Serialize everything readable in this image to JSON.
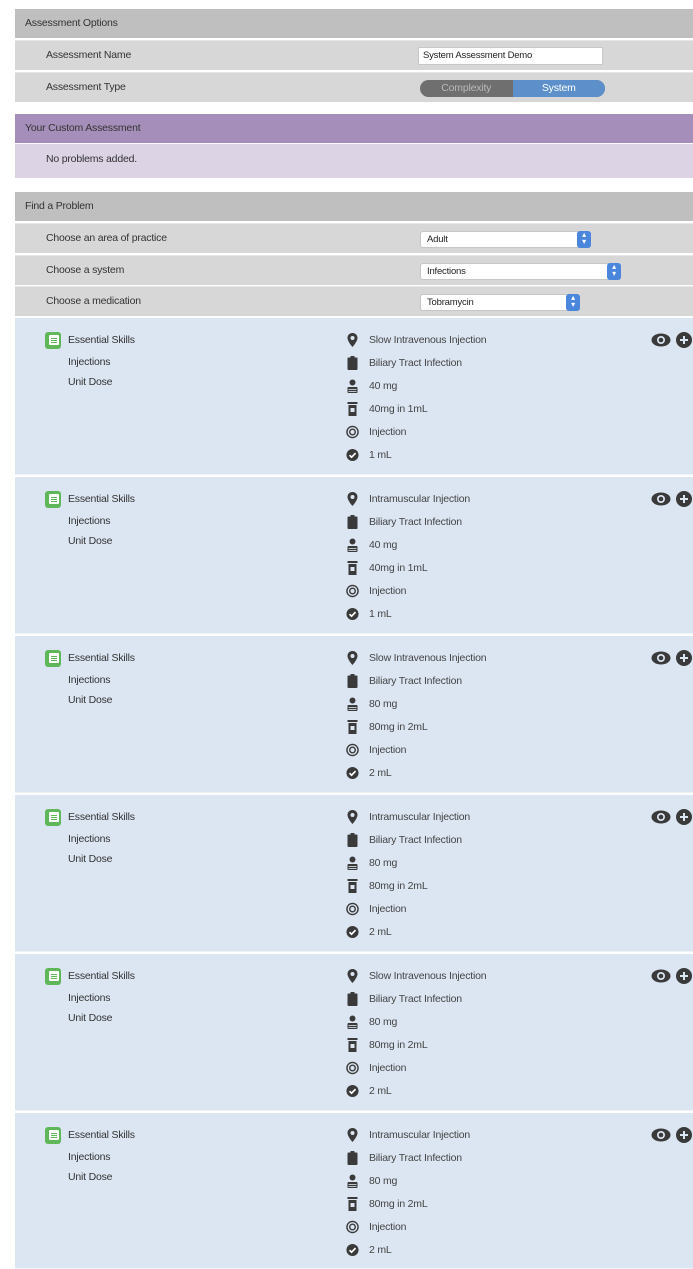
{
  "assessment_options": {
    "header": "Assessment Options",
    "name_label": "Assessment Name",
    "name_value": "System Assessment Demo",
    "type_label": "Assessment Type",
    "type_options": [
      "Complexity",
      "System"
    ],
    "type_selected": "System"
  },
  "custom_assessment": {
    "header": "Your Custom Assessment",
    "empty_text": "No problems added."
  },
  "find_problem": {
    "header": "Find a Problem",
    "area_label": "Choose an area of practice",
    "area_value": "Adult",
    "system_label": "Choose a system",
    "system_value": "Infections",
    "medication_label": "Choose a medication",
    "medication_value": "Tobramycin"
  },
  "colors": {
    "header_gray": "#bfbfbf",
    "row_gray": "#d7d7d7",
    "purple_header": "#a58fba",
    "purple_row": "#dcd3e4",
    "card_blue": "#dce6f2",
    "accent_blue": "#5d8fcb",
    "book_green": "#5fb75a"
  },
  "icons": {
    "route": "map-pin-icon",
    "indication": "clipboard-icon",
    "dose": "person-icon",
    "strength": "vial-icon",
    "form": "target-icon",
    "volume": "check-circle-icon",
    "view": "eye-icon",
    "add": "plus-circle-icon",
    "category": "book-icon"
  },
  "problems": [
    {
      "category": "Essential Skills",
      "subcategory": "Injections",
      "type": "Unit Dose",
      "route": "Slow Intravenous Injection",
      "indication": "Biliary Tract Infection",
      "dose": "40 mg",
      "strength": "40mg in 1mL",
      "form": "Injection",
      "volume": "1 mL"
    },
    {
      "category": "Essential Skills",
      "subcategory": "Injections",
      "type": "Unit Dose",
      "route": "Intramuscular Injection",
      "indication": "Biliary Tract Infection",
      "dose": "40 mg",
      "strength": "40mg in 1mL",
      "form": "Injection",
      "volume": "1 mL"
    },
    {
      "category": "Essential Skills",
      "subcategory": "Injections",
      "type": "Unit Dose",
      "route": "Slow Intravenous Injection",
      "indication": "Biliary Tract Infection",
      "dose": "80 mg",
      "strength": "80mg in 2mL",
      "form": "Injection",
      "volume": "2 mL"
    },
    {
      "category": "Essential Skills",
      "subcategory": "Injections",
      "type": "Unit Dose",
      "route": "Intramuscular Injection",
      "indication": "Biliary Tract Infection",
      "dose": "80 mg",
      "strength": "80mg in 2mL",
      "form": "Injection",
      "volume": "2 mL"
    },
    {
      "category": "Essential Skills",
      "subcategory": "Injections",
      "type": "Unit Dose",
      "route": "Slow Intravenous Injection",
      "indication": "Biliary Tract Infection",
      "dose": "80 mg",
      "strength": "80mg in 2mL",
      "form": "Injection",
      "volume": "2 mL"
    },
    {
      "category": "Essential Skills",
      "subcategory": "Injections",
      "type": "Unit Dose",
      "route": "Intramuscular Injection",
      "indication": "Biliary Tract Infection",
      "dose": "80 mg",
      "strength": "80mg in 2mL",
      "form": "Injection",
      "volume": "2 mL"
    }
  ]
}
